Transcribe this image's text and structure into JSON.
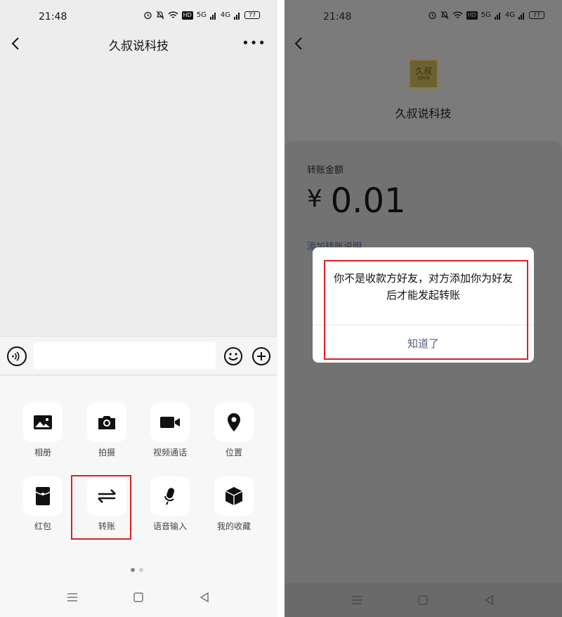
{
  "left": {
    "status": {
      "time": "21:48",
      "hd": "HD",
      "net1": "5G",
      "net2": "4G",
      "battery": "77"
    },
    "title": "久叔说科技",
    "tools": [
      {
        "label": "相册",
        "icon": "image-icon"
      },
      {
        "label": "拍摄",
        "icon": "camera-icon"
      },
      {
        "label": "视频通话",
        "icon": "video-icon"
      },
      {
        "label": "位置",
        "icon": "location-icon"
      },
      {
        "label": "红包",
        "icon": "red-packet-icon"
      },
      {
        "label": "转账",
        "icon": "transfer-icon"
      },
      {
        "label": "语音输入",
        "icon": "microphone-icon"
      },
      {
        "label": "我的收藏",
        "icon": "favorites-icon"
      }
    ]
  },
  "right": {
    "status": {
      "time": "21:48",
      "hd": "HD",
      "net1": "5G",
      "net2": "4G",
      "battery": "77"
    },
    "avatar_text_top": "久叔",
    "avatar_text_bottom": "说科技",
    "payee": "久叔说科技",
    "amount_label": "转账金额",
    "currency": "¥",
    "amount": "0.01",
    "add_note": "添加转账说明",
    "dialog": {
      "message": "你不是收款方好友，对方添加你为好友后才能发起转账",
      "button": "知道了"
    }
  }
}
